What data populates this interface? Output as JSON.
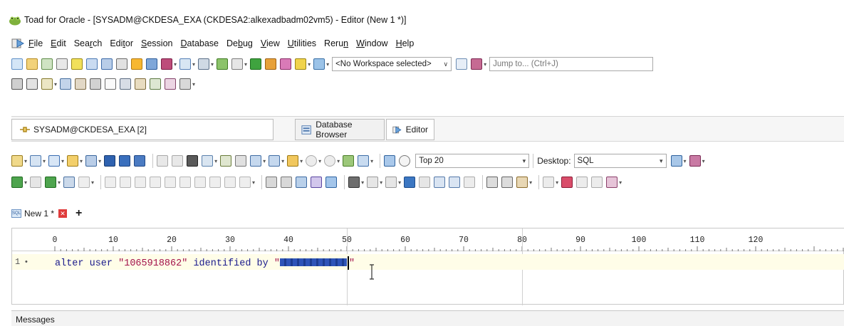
{
  "window": {
    "title": "Toad for Oracle - [SYSADM@CKDESA_EXA (CKDESA2:alkexadbadm02vm5) - Editor (New 1 *)]"
  },
  "menu": {
    "items": [
      {
        "label": "File",
        "accel": "F"
      },
      {
        "label": "Edit",
        "accel": "E"
      },
      {
        "label": "Search",
        "accel": "r"
      },
      {
        "label": "Editor",
        "accel": "t"
      },
      {
        "label": "Session",
        "accel": "S"
      },
      {
        "label": "Database",
        "accel": "D"
      },
      {
        "label": "Debug",
        "accel": "b"
      },
      {
        "label": "View",
        "accel": "V"
      },
      {
        "label": "Utilities",
        "accel": "U"
      },
      {
        "label": "Rerun",
        "accel": "n"
      },
      {
        "label": "Window",
        "accel": "W"
      },
      {
        "label": "Help",
        "accel": "H"
      }
    ]
  },
  "toolbar": {
    "workspace_select": "<No Workspace selected>",
    "jump_placeholder": "Jump to... (Ctrl+J)",
    "top_select": "Top 20",
    "desktop_label": "Desktop:",
    "desktop_select": "SQL"
  },
  "connection": {
    "tab_label": "SYSADM@CKDESA_EXA [2]"
  },
  "view_tabs": {
    "database_browser": "Database Browser",
    "editor": "Editor"
  },
  "document_tab": {
    "label": "New 1 *",
    "sql_badge": "SQL"
  },
  "ruler": {
    "marks": [
      "0",
      "10",
      "20",
      "30",
      "40",
      "50",
      "60",
      "70",
      "80",
      "90",
      "100",
      "110",
      "120"
    ]
  },
  "editor": {
    "line_number": "1",
    "line_marker": "•",
    "code_keyword": "alter user ",
    "code_user": "\"1065918862\"",
    "code_mid": " identified by ",
    "code_quote_open": "\"",
    "code_quote_close": "\""
  },
  "messages": {
    "label": "Messages"
  },
  "colors": {
    "code_keyword": "#1a1a8c",
    "code_string": "#a3124a",
    "current_line": "#fffde8",
    "redaction": "#2e54b8"
  }
}
